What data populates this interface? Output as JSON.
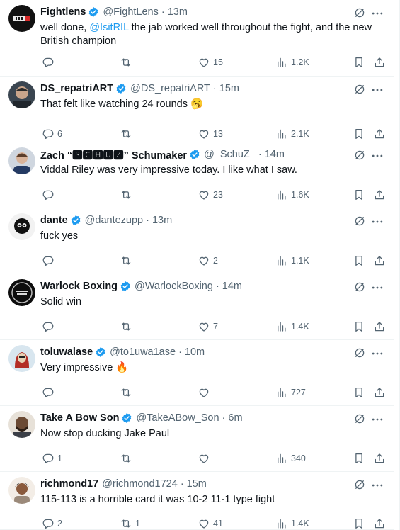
{
  "tweets": [
    {
      "name": "Fightlens",
      "handle": "@FightLens",
      "time": "13m",
      "text_pre": "well done, ",
      "mention": "@IsitRIL",
      "text_post": " the jab worked well throughout the fight, and the new British champion",
      "replies": "",
      "retweets": "",
      "likes": "15",
      "views": "1.2K",
      "verified": true,
      "emoji": ""
    },
    {
      "name": "DS_repatriART",
      "handle": "@DS_repatriART",
      "time": "15m",
      "text_pre": "That felt like watching 24 rounds ",
      "mention": "",
      "text_post": "",
      "replies": "6",
      "retweets": "",
      "likes": "13",
      "views": "2.1K",
      "verified": true,
      "emoji": "🥱"
    },
    {
      "name": "Zach “🆂🅲🅷🆄🆉” Schumaker",
      "handle": "@_SchuZ_",
      "time": "14m",
      "text_pre": "Viddal Riley was very impressive today. I like what I saw.",
      "mention": "",
      "text_post": "",
      "replies": "",
      "retweets": "",
      "likes": "23",
      "views": "1.6K",
      "verified": true,
      "emoji": ""
    },
    {
      "name": "dante",
      "handle": "@dantezupp",
      "time": "13m",
      "text_pre": "fuck yes",
      "mention": "",
      "text_post": "",
      "replies": "",
      "retweets": "",
      "likes": "2",
      "views": "1.1K",
      "verified": true,
      "emoji": ""
    },
    {
      "name": "Warlock Boxing",
      "handle": "@WarlockBoxing",
      "time": "14m",
      "text_pre": "Solid win",
      "mention": "",
      "text_post": "",
      "replies": "",
      "retweets": "",
      "likes": "7",
      "views": "1.4K",
      "verified": true,
      "emoji": ""
    },
    {
      "name": "toluwalase",
      "handle": "@to1uwa1ase",
      "time": "10m",
      "text_pre": "Very impressive ",
      "mention": "",
      "text_post": "",
      "replies": "",
      "retweets": "",
      "likes": "",
      "views": "727",
      "verified": true,
      "emoji": "🔥"
    },
    {
      "name": "Take A Bow Son",
      "handle": "@TakeABow_Son",
      "time": "6m",
      "text_pre": "Now stop ducking Jake Paul",
      "mention": "",
      "text_post": "",
      "replies": "1",
      "retweets": "",
      "likes": "",
      "views": "340",
      "verified": true,
      "emoji": ""
    },
    {
      "name": "richmond17",
      "handle": "@richmond1724",
      "time": "15m",
      "text_pre": "115-113 is a horrible card it was 10-2 11-1 type fight",
      "mention": "",
      "text_post": "",
      "replies": "2",
      "retweets": "1",
      "likes": "41",
      "views": "1.4K",
      "verified": false,
      "emoji": ""
    }
  ],
  "separator": "·",
  "icons": {
    "verified": "verified-badge-icon",
    "grok": "grok-icon",
    "more": "more-options-icon",
    "reply": "reply-icon",
    "retweet": "retweet-icon",
    "like": "like-icon",
    "views": "views-icon",
    "bookmark": "bookmark-icon",
    "share": "share-icon"
  },
  "colors": {
    "accent": "#1d9bf0",
    "text": "#0f1419",
    "secondary": "#536471",
    "divider": "#eff3f4"
  }
}
